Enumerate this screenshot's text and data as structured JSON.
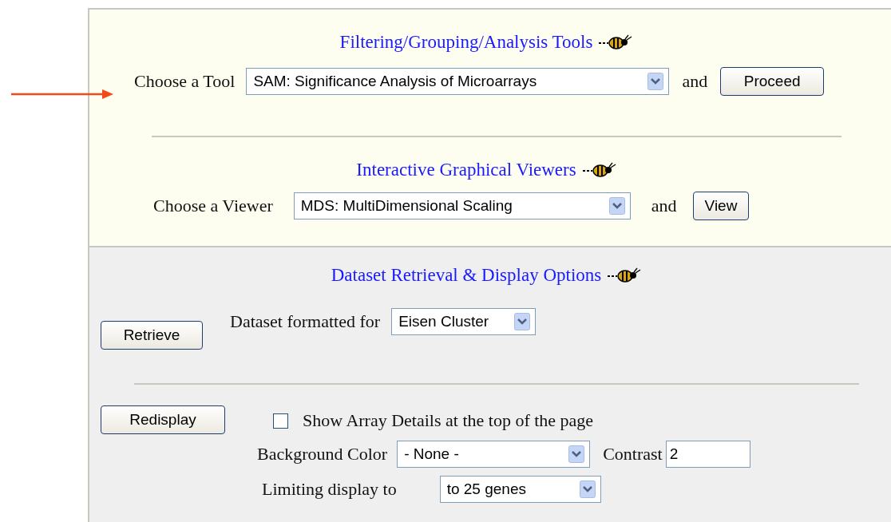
{
  "tools": {
    "title": "Filtering/Grouping/Analysis Tools",
    "label": "Choose a Tool",
    "select": "SAM: Significance Analysis of Microarrays",
    "joiner": "and",
    "button": "Proceed"
  },
  "viewers": {
    "title": "Interactive Graphical Viewers",
    "label": "Choose a Viewer",
    "select": "MDS: MultiDimensional Scaling",
    "joiner": "and",
    "button": "View"
  },
  "dataset": {
    "title": "Dataset Retrieval & Display Options",
    "button": "Retrieve",
    "label": "Dataset formatted for",
    "select": "Eisen Cluster"
  },
  "display": {
    "button": "Redisplay",
    "show_details": {
      "label": "Show Array Details at the top of the page",
      "checked": false
    },
    "background_label": "Background Color",
    "background_select": "- None -",
    "contrast_label": "Contrast",
    "contrast_value": "2",
    "limit_label": "Limiting display to",
    "limit_select": "to 25 genes"
  }
}
